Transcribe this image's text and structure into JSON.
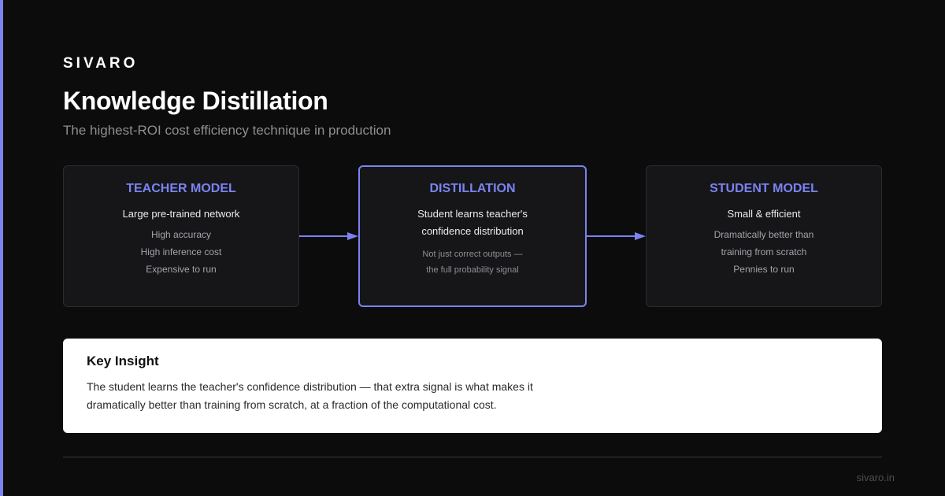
{
  "brand": "SIVARO",
  "title": "Knowledge Distillation",
  "subtitle": "The highest-ROI cost efficiency technique in production",
  "colors": {
    "accent": "#7b83f0",
    "background": "#0c0c0c",
    "card": "#161619"
  },
  "cards": [
    {
      "title": "TEACHER MODEL",
      "main": [
        "Large pre-trained network"
      ],
      "sub": [
        "High accuracy",
        "High inference cost",
        "Expensive to run"
      ]
    },
    {
      "title": "DISTILLATION",
      "main": [
        "Student learns teacher's",
        "confidence distribution"
      ],
      "sub": [
        "Not just correct outputs —",
        "the full probability signal"
      ]
    },
    {
      "title": "STUDENT MODEL",
      "main": [
        "Small & efficient"
      ],
      "sub": [
        "Dramatically better than",
        "training from scratch",
        "Pennies to run"
      ]
    }
  ],
  "insight": {
    "title": "Key Insight",
    "lines": [
      "The student learns the teacher's confidence distribution — that extra signal is what makes it",
      "dramatically better than training from scratch, at a fraction of the computational cost."
    ]
  },
  "footer": {
    "url": "sivaro.in"
  }
}
